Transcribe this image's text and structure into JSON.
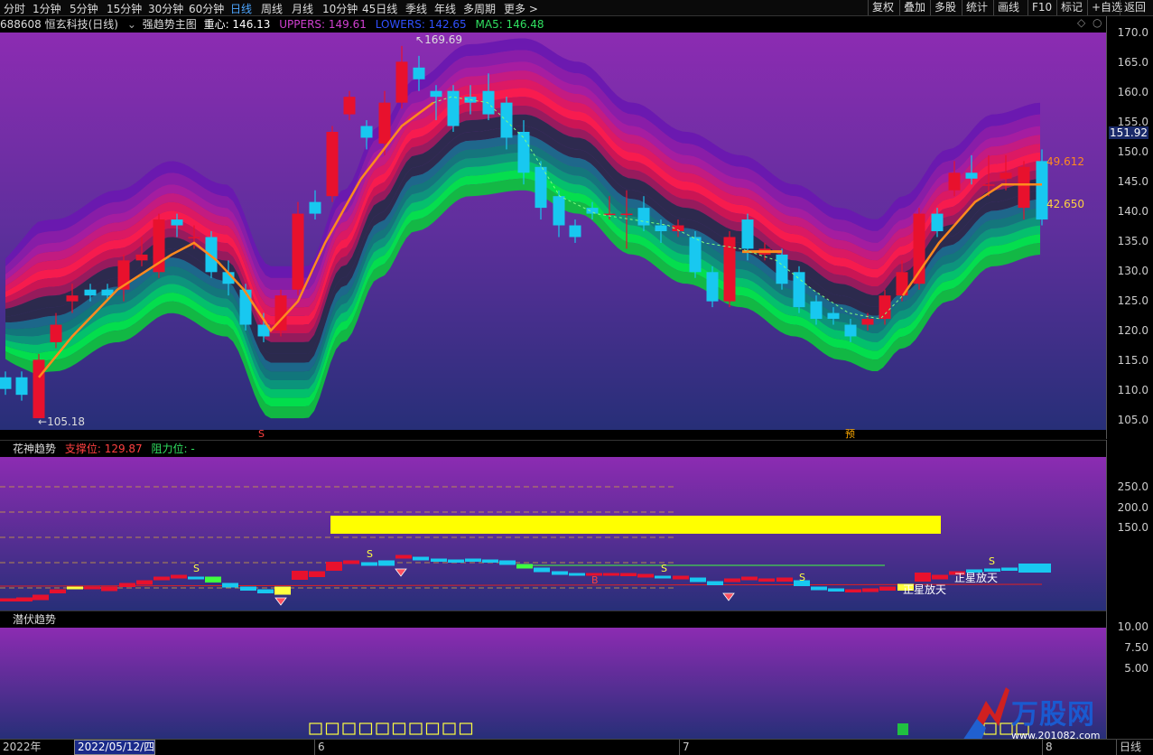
{
  "toolbar": {
    "periods": [
      "分时",
      "1分钟",
      "5分钟",
      "15分钟",
      "30分钟",
      "60分钟",
      "日线",
      "周线",
      "月线",
      "10分钟",
      "45日线",
      "季线",
      "年线",
      "多周期",
      "更多 >"
    ],
    "active_period": "日线",
    "right_buttons": [
      "复权",
      "叠加",
      "多股",
      "统计",
      "画线",
      "F10",
      "标记",
      "+自选",
      "返回"
    ]
  },
  "main_info": {
    "security": "688608 恒玄科技(日线)",
    "indicator": "强趋势主图",
    "center_label": "重心: 146.13",
    "uppers_label": "UPPERS: 149.61",
    "lowers_label": "LOWERS: 142.65",
    "ma5_label": "MA5: 146.48"
  },
  "main_axis": {
    "ticks": [
      "170.0",
      "165.0",
      "160.0",
      "155.0",
      "150.0",
      "145.0",
      "140.0",
      "135.0",
      "130.0",
      "125.0",
      "120.0",
      "115.0",
      "110.0",
      "105.0"
    ],
    "current_price": "151.92"
  },
  "main_annotations": {
    "high": "169.69",
    "low": "105.18",
    "upper_right": "49.612",
    "lower_right": "42.650",
    "marker_s": "S",
    "marker_yu": "预"
  },
  "sub1_info": {
    "name": "花神趋势",
    "support": "支撑位: 129.87",
    "resistance": "阻力位: -"
  },
  "sub1_axis": {
    "ticks": [
      "250.0",
      "200.0",
      "150.0"
    ]
  },
  "sub1_annotations": {
    "s_marks": [
      "S",
      "S",
      "S",
      "S",
      "S"
    ],
    "b_mark": "B",
    "text1": "正星放天",
    "text2": "正星放天"
  },
  "sub2_info": {
    "name": "潜伏趋势"
  },
  "sub2_axis": {
    "ticks": [
      "10.00",
      "7.50",
      "5.00"
    ]
  },
  "date_axis": {
    "year": "2022年",
    "cursor_date": "2022/05/12/四",
    "month6": "6",
    "month7": "7",
    "month8": "8",
    "period": "日线"
  },
  "watermark": {
    "brand": "万股网",
    "url": "www.201082.com"
  },
  "colors": {
    "up": "#e8112d",
    "down": "#18c8f0",
    "ma": "#ff8a1e",
    "background_top": "#8a2db0",
    "background_bottom": "#28327a",
    "highlight_bar": "#ffff00"
  },
  "icons": {
    "indicator_toggle": "chevron-down-icon",
    "diamond": "diamond-icon"
  }
}
